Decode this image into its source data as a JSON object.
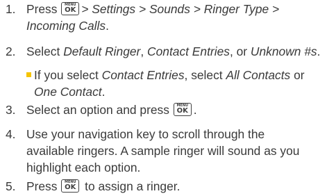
{
  "menu_key": {
    "top": "MENU",
    "bottom": "OK",
    "icon": "menu-ok-key-icon"
  },
  "bullet_color": "#f5c400",
  "steps": [
    {
      "number": "1.",
      "press": "Press",
      "path": "> Settings > Sounds > Ringer Type >",
      "path_end": "Incoming Calls",
      "end": "."
    },
    {
      "number": "2.",
      "select": "Select",
      "opt1": "Default Ringer",
      "comma1": ",",
      "opt2": "Contact Entries",
      "comma2": ", or",
      "opt3": "Unknown #s",
      "end": "."
    },
    {
      "number": "3.",
      "text": "Select an option and press",
      "end": "."
    },
    {
      "number": "4.",
      "line1": "Use your navigation key to scroll through the",
      "line2": "available ringers. A sample ringer will sound as you",
      "line3": "highlight each option."
    },
    {
      "number": "5.",
      "press": "Press",
      "text": "to assign a ringer."
    }
  ],
  "sub_bullet": {
    "prefix": "If you select",
    "opt": "Contact Entries",
    "mid": ", select",
    "opt2": "All Contacts",
    "or": "or",
    "opt3": "One Contact",
    "end": "."
  }
}
